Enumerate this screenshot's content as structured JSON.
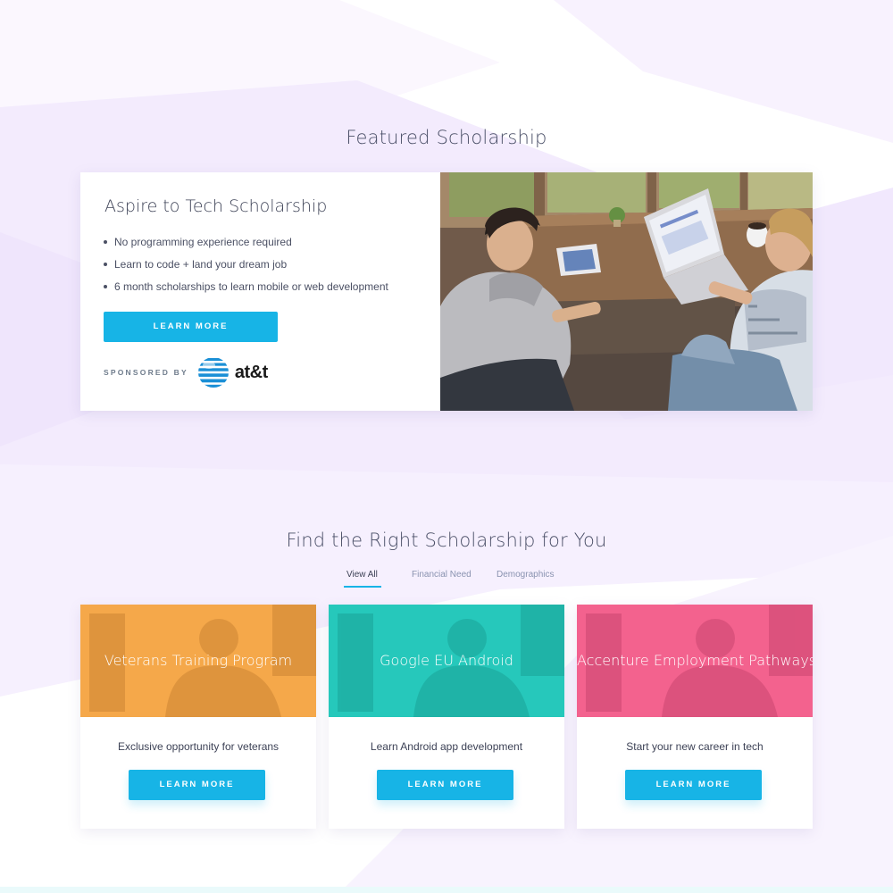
{
  "featured": {
    "section_title": "Featured Scholarship",
    "card": {
      "title": "Aspire to Tech Scholarship",
      "bullets": [
        "No programming experience required",
        "Learn to code + land your dream job",
        "6 month scholarships to learn mobile or web development"
      ],
      "button_label": "LEARN MORE",
      "sponsor_label": "SPONSORED BY",
      "sponsor_logo": "at&t",
      "photo_icon": "two-people-laptop-photo"
    }
  },
  "find": {
    "section_title": "Find the Right Scholarship for You",
    "tabs": [
      {
        "label": "View All",
        "active": true
      },
      {
        "label": "Financial Need",
        "active": false
      },
      {
        "label": "Demographics",
        "active": false
      }
    ]
  },
  "programs": [
    {
      "title": "Veterans Training Program",
      "description": "Exclusive opportunity for veterans",
      "button_label": "LEARN MORE",
      "color": "#f5a84a"
    },
    {
      "title": "Google EU Android",
      "description": "Learn Android app development",
      "button_label": "LEARN MORE",
      "color": "#26c8bb"
    },
    {
      "title": "Accenture Employment Pathways",
      "description": "Start your new career in tech",
      "button_label": "LEARN MORE",
      "color": "#f3628e"
    }
  ],
  "colors": {
    "accent": "#17b4e6",
    "background_tint": "#f3ecfc"
  }
}
